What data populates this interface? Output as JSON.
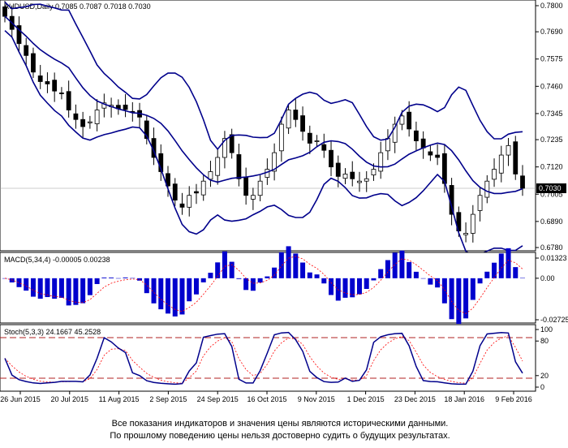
{
  "main": {
    "header": "AUDUSD,Daily  0.7085 0.7087 0.7018 0.7030",
    "price_label": "0.7030",
    "price_ticks": [
      "0.7800",
      "0.7690",
      "0.7575",
      "0.7460",
      "0.7345",
      "0.7235",
      "0.7120",
      "0.7005",
      "0.6890",
      "0.6780"
    ]
  },
  "macd": {
    "header": "MACD(5,34,4) -0.00005 0.00238",
    "ticks": [
      "0.01323",
      "0.00",
      "-0.02725"
    ]
  },
  "stoch": {
    "header": "Stoch(5,3,3) 24.1667 45.2528",
    "ticks": [
      "100",
      "80",
      "20",
      "0"
    ]
  },
  "x_axis": {
    "dates": [
      "26 Jun 2015",
      "20 Jul 2015",
      "11 Aug 2015",
      "2 Sep 2015",
      "24 Sep 2015",
      "16 Oct 2015",
      "9 Nov 2015",
      "1 Dec 2015",
      "23 Dec 2015",
      "18 Jan 2016",
      "9 Feb 2016"
    ]
  },
  "disclaimer": {
    "line1": "Все показания индикаторов и значения цены являются историческими данными.",
    "line2": "По прошлому поведению цены нельзя достоверно судить о будущих результатах."
  },
  "colors": {
    "candles": "#000000",
    "bollinger": "#00008b",
    "macd_hist": "#0000cd",
    "signal": "#ff0000",
    "levels": "#b22222"
  },
  "chart_data": {
    "type": "candlestick",
    "symbol": "AUDUSD",
    "timeframe": "Daily",
    "last": {
      "open": 0.7085,
      "high": 0.7087,
      "low": 0.7018,
      "close": 0.703
    },
    "close_series": [
      0.7755,
      0.77,
      0.764,
      0.759,
      0.752,
      0.748,
      0.747,
      0.744,
      0.743,
      0.736,
      0.732,
      0.729,
      0.731,
      0.736,
      0.739,
      0.738,
      0.7365,
      0.7362,
      0.735,
      0.733,
      0.724,
      0.716,
      0.71,
      0.704,
      0.698,
      0.695,
      0.7,
      0.701,
      0.706,
      0.71,
      0.716,
      0.724,
      0.718,
      0.707,
      0.7,
      0.7,
      0.706,
      0.711,
      0.718,
      0.73,
      0.736,
      0.732,
      0.727,
      0.722,
      0.723,
      0.719,
      0.712,
      0.708,
      0.709,
      0.707,
      0.706,
      0.707,
      0.711,
      0.718,
      0.724,
      0.73,
      0.7335,
      0.728,
      0.723,
      0.72,
      0.717,
      0.716,
      0.705,
      0.692,
      0.685,
      0.684,
      0.692,
      0.7,
      0.706,
      0.711,
      0.717,
      0.721,
      0.709,
      0.703
    ],
    "y_ticks": [
      0.78,
      0.769,
      0.7575,
      0.746,
      0.7345,
      0.7235,
      0.712,
      0.7005,
      0.689,
      0.678
    ],
    "ylim": [
      0.676,
      0.781
    ],
    "macd": {
      "value": -5e-05,
      "signal": 0.00238,
      "ylim": [
        -0.02725,
        0.01323
      ]
    },
    "stochastic": {
      "k": 24.1667,
      "d": 45.2528,
      "levels": [
        20,
        80
      ],
      "ylim": [
        0,
        100
      ]
    }
  }
}
